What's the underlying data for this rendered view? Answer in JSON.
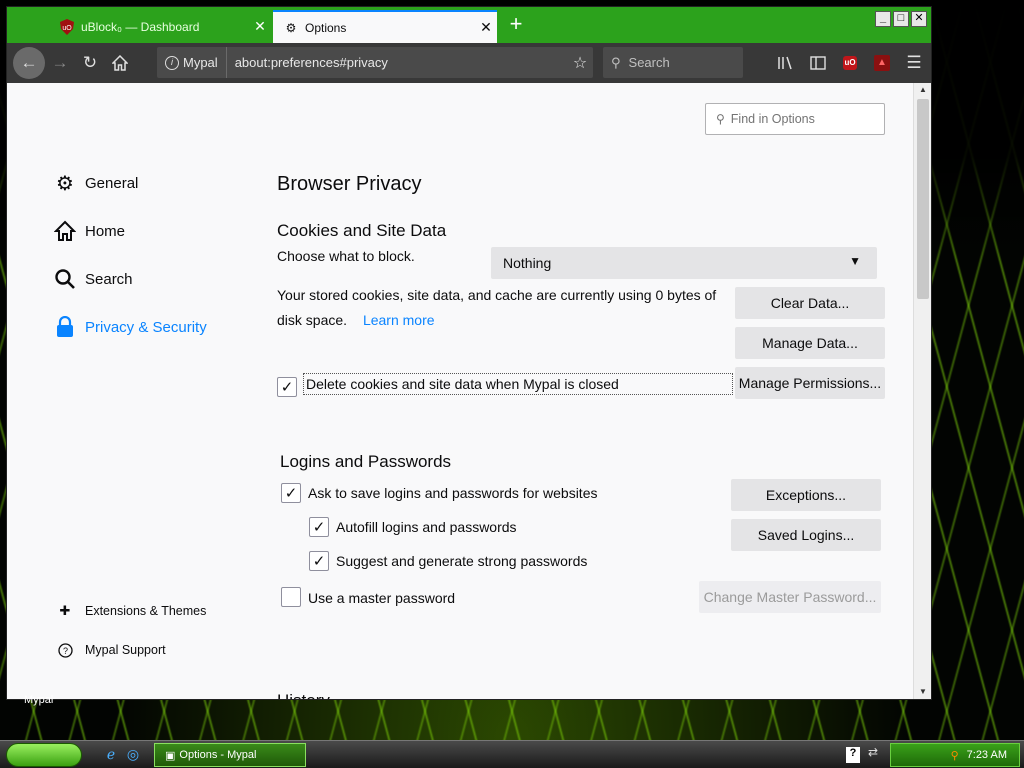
{
  "desktop": {
    "label": "Mypal"
  },
  "tabs": [
    {
      "title": "uBlock₀ — Dashboard",
      "active": false,
      "icon": "ublock-icon"
    },
    {
      "title": "Options",
      "active": true,
      "icon": "gear-icon"
    }
  ],
  "new_tab_label": "+",
  "navbar": {
    "identity_label": "Mypal",
    "url": "about:preferences#privacy",
    "search_placeholder": "Search"
  },
  "find_in_options_placeholder": "Find in Options",
  "sidebar": {
    "items": [
      {
        "label": "General",
        "icon": "gear-icon"
      },
      {
        "label": "Home",
        "icon": "home-icon"
      },
      {
        "label": "Search",
        "icon": "search-icon"
      },
      {
        "label": "Privacy & Security",
        "icon": "lock-icon",
        "active": true
      }
    ],
    "footer": [
      {
        "label": "Extensions & Themes",
        "icon": "puzzle-icon"
      },
      {
        "label": "Mypal Support",
        "icon": "help-icon"
      }
    ]
  },
  "page": {
    "title": "Browser Privacy",
    "cookies": {
      "heading": "Cookies and Site Data",
      "choose_label": "Choose what to block.",
      "block_value": "Nothing",
      "usage_text_1": "Your stored cookies, site data, and cache are currently using 0 bytes of",
      "usage_text_2": "disk space.",
      "learn_more": "Learn more",
      "clear_data": "Clear Data...",
      "manage_data": "Manage Data...",
      "manage_permissions": "Manage Permissions...",
      "delete_on_close": "Delete cookies and site data when Mypal is closed",
      "delete_on_close_checked": true
    },
    "logins": {
      "heading": "Logins and Passwords",
      "ask_to_save": "Ask to save logins and passwords for websites",
      "ask_to_save_checked": true,
      "autofill": "Autofill logins and passwords",
      "autofill_checked": true,
      "suggest": "Suggest and generate strong passwords",
      "suggest_checked": true,
      "master_password": "Use a master password",
      "master_password_checked": false,
      "exceptions": "Exceptions...",
      "saved_logins": "Saved Logins...",
      "change_master": "Change Master Password..."
    },
    "history_heading": "History"
  },
  "taskbar": {
    "task_label": "Options - Mypal",
    "clock": "7:23 AM"
  }
}
